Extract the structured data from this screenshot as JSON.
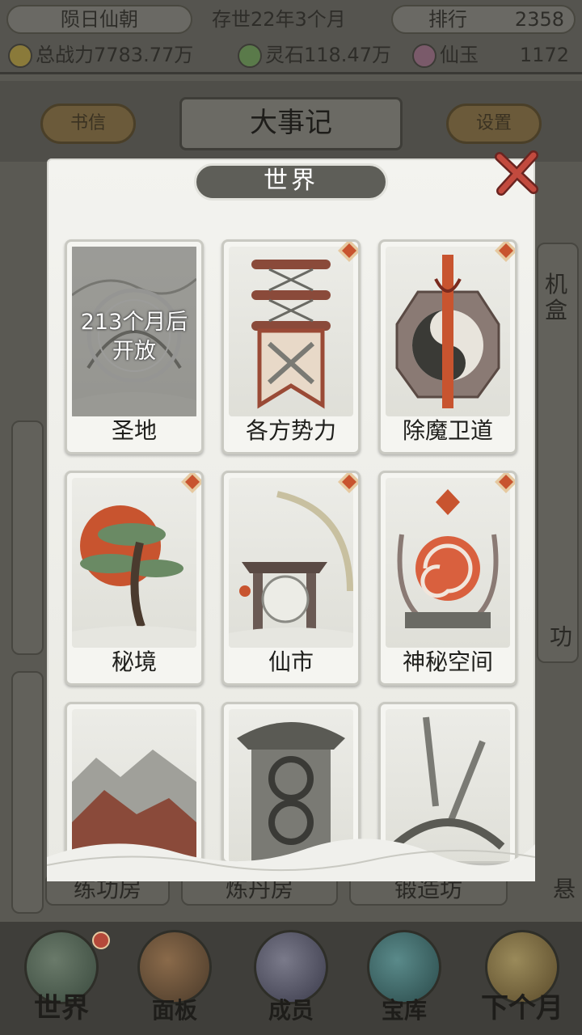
{
  "header": {
    "dynasty": "陨日仙朝",
    "era": "存世22年3个月",
    "rank_label": "排行",
    "rank_value": "2358",
    "power_label": "总战力7783.77万",
    "spirit_stone": "灵石118.47万",
    "jade_label": "仙玉",
    "jade_value": "1172"
  },
  "subbar": {
    "left_button": "书信",
    "title": "大事记",
    "right_button": "设置"
  },
  "background_labels": {
    "room1": "练功房",
    "room2": "炼丹房",
    "room3": "锻造坊",
    "side_right_1": "机",
    "side_right_2": "盒",
    "side_right_3": "功",
    "side_right_4": "悬"
  },
  "modal": {
    "title": "世界",
    "cards": [
      {
        "name": "圣地",
        "locked": true,
        "lock_text_line1": "213个月后",
        "lock_text_line2": "开放",
        "badge": false
      },
      {
        "name": "各方势力",
        "locked": false,
        "badge": true
      },
      {
        "name": "除魔卫道",
        "locked": false,
        "badge": true
      },
      {
        "name": "秘境",
        "locked": false,
        "badge": true
      },
      {
        "name": "仙市",
        "locked": false,
        "badge": true
      },
      {
        "name": "神秘空间",
        "locked": false,
        "badge": true
      },
      {
        "name": "",
        "locked": false,
        "badge": false
      },
      {
        "name": "",
        "locked": false,
        "badge": false
      },
      {
        "name": "",
        "locked": false,
        "badge": false
      }
    ]
  },
  "bottom_nav": {
    "items": [
      "世界",
      "面板",
      "成员",
      "宝库",
      "下个月"
    ]
  },
  "colors": {
    "badge": "#c8542f",
    "accent_red": "#b5493a",
    "title_pill": "#5e5e58"
  }
}
